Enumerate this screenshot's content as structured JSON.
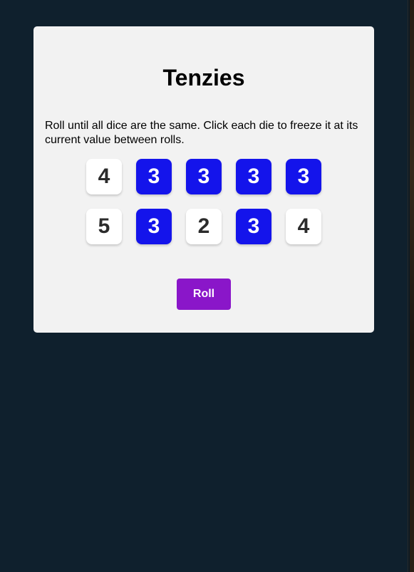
{
  "app": {
    "title": "Tenzies",
    "instructions": "Roll until all dice are the same. Click each die to freeze it at its current value between rolls."
  },
  "dice": [
    {
      "value": "4",
      "held": false
    },
    {
      "value": "3",
      "held": true
    },
    {
      "value": "3",
      "held": true
    },
    {
      "value": "3",
      "held": true
    },
    {
      "value": "3",
      "held": true
    },
    {
      "value": "5",
      "held": false
    },
    {
      "value": "3",
      "held": true
    },
    {
      "value": "2",
      "held": false
    },
    {
      "value": "3",
      "held": true
    },
    {
      "value": "4",
      "held": false
    }
  ],
  "roll_button": {
    "label": "Roll"
  },
  "colors": {
    "page_background": "#0f202d",
    "card_background": "#f2f2f2",
    "held_die": "#1414eb",
    "unheld_die": "#ffffff",
    "roll_button": "#8a16c9"
  }
}
